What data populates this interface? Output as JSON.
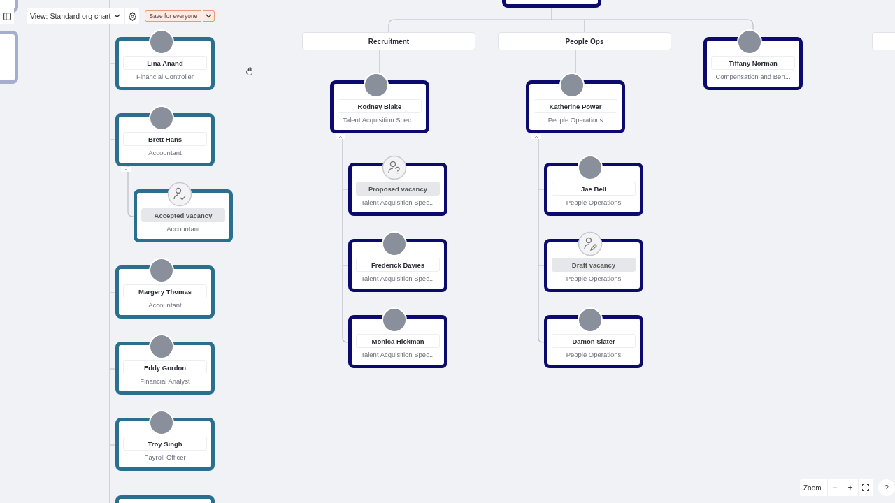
{
  "toolbar": {
    "view_label": "View: Standard org chart",
    "save_label": "Save for everyone"
  },
  "finance": {
    "nodes": [
      {
        "kind": "person",
        "name": "Lina Anand",
        "title": "Financial Controller",
        "color": "#2b6f8f"
      },
      {
        "kind": "person",
        "name": "Brett Hans",
        "title": "Accountant",
        "color": "#2b6f8f",
        "children": [
          {
            "kind": "accepted_vacancy",
            "name": "Accepted vacancy",
            "title": "Accountant",
            "color": "#2b6f8f"
          }
        ]
      },
      {
        "kind": "person",
        "name": "Margery Thomas",
        "title": "Accountant",
        "color": "#2b6f8f"
      },
      {
        "kind": "person",
        "name": "Eddy Gordon",
        "title": "Financial Analyst",
        "color": "#2b6f8f"
      },
      {
        "kind": "person",
        "name": "Troy Singh",
        "title": "Payroll Officer",
        "color": "#2b6f8f"
      }
    ]
  },
  "departments": [
    {
      "name": "Recruitment",
      "lead": {
        "kind": "person",
        "name": "Rodney Blake",
        "title": "Talent Acquisition Spec...",
        "color": "#0c0a6e"
      },
      "members": [
        {
          "kind": "proposed_vacancy",
          "name": "Proposed vacancy",
          "title": "Talent Acquisition Spec...",
          "color": "#0c0a6e"
        },
        {
          "kind": "person",
          "name": "Frederick Davies",
          "title": "Talent Acquisition Spec...",
          "color": "#0c0a6e"
        },
        {
          "kind": "person",
          "name": "Monica Hickman",
          "title": "Talent Acquisition Spec...",
          "color": "#0c0a6e"
        }
      ]
    },
    {
      "name": "People Ops",
      "lead": {
        "kind": "person",
        "name": "Katherine Power",
        "title": "People Operations",
        "color": "#0c0a6e"
      },
      "members": [
        {
          "kind": "person",
          "name": "Jae Bell",
          "title": "People Operations",
          "color": "#0c0a6e"
        },
        {
          "kind": "draft_vacancy",
          "name": "Draft vacancy",
          "title": "People Operations",
          "color": "#0c0a6e"
        },
        {
          "kind": "person",
          "name": "Damon Slater",
          "title": "People Operations",
          "color": "#0c0a6e"
        }
      ]
    }
  ],
  "standalone": [
    {
      "kind": "person",
      "name": "Tiffany Norman",
      "title": "Compensation and Ben...",
      "color": "#0c0a6e"
    }
  ],
  "zoom": {
    "label": "Zoom",
    "minus": "−",
    "plus": "+"
  },
  "help": "?"
}
